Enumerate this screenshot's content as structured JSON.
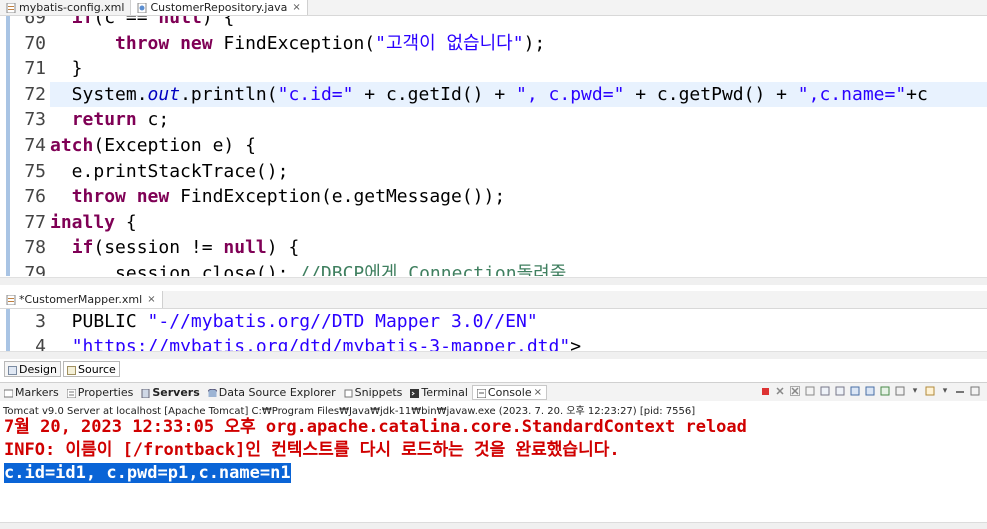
{
  "top_tabs": [
    {
      "label": "mybatis-config.xml",
      "active": false
    },
    {
      "label": "CustomerRepository.java",
      "active": true,
      "close": "×"
    }
  ],
  "java_editor": {
    "lines": [
      {
        "num": "69",
        "parts": [
          [
            "",
            "  "
          ],
          [
            "kw",
            "if"
          ],
          [
            "",
            "(c == "
          ],
          [
            "kw",
            "null"
          ],
          [
            "",
            ") {"
          ]
        ]
      },
      {
        "num": "70",
        "parts": [
          [
            "",
            "      "
          ],
          [
            "kw",
            "throw"
          ],
          [
            "",
            " "
          ],
          [
            "kw",
            "new"
          ],
          [
            "",
            " FindException("
          ],
          [
            "str",
            "\"고객이 없습니다\""
          ],
          [
            "",
            ");"
          ]
        ]
      },
      {
        "num": "71",
        "parts": [
          [
            "",
            "  }"
          ]
        ]
      },
      {
        "num": "72",
        "highlight": true,
        "parts": [
          [
            "",
            "  System."
          ],
          [
            "it",
            "out"
          ],
          [
            "",
            ".println("
          ],
          [
            "str",
            "\"c.id=\""
          ],
          [
            "",
            " + c.getId() + "
          ],
          [
            "str",
            "\", c.pwd=\""
          ],
          [
            "",
            " + c.getPwd() + "
          ],
          [
            "str",
            "\",c.name=\""
          ],
          [
            "",
            "+c"
          ]
        ]
      },
      {
        "num": "73",
        "parts": [
          [
            "",
            "  "
          ],
          [
            "kw",
            "return"
          ],
          [
            "",
            " c;"
          ]
        ]
      },
      {
        "num": "74",
        "parts": [
          [
            "kw",
            "atch"
          ],
          [
            "",
            "(Exception e) {"
          ]
        ]
      },
      {
        "num": "75",
        "parts": [
          [
            "",
            "  e.printStackTrace();"
          ]
        ]
      },
      {
        "num": "76",
        "parts": [
          [
            "",
            "  "
          ],
          [
            "kw",
            "throw"
          ],
          [
            "",
            " "
          ],
          [
            "kw",
            "new"
          ],
          [
            "",
            " FindException(e.getMessage());"
          ]
        ]
      },
      {
        "num": "77",
        "parts": [
          [
            "kw",
            "inally"
          ],
          [
            "",
            " {"
          ]
        ]
      },
      {
        "num": "78",
        "parts": [
          [
            "",
            "  "
          ],
          [
            "kw",
            "if"
          ],
          [
            "",
            "(session != "
          ],
          [
            "kw",
            "null"
          ],
          [
            "",
            ") {"
          ]
        ]
      },
      {
        "num": "79",
        "parts": [
          [
            "",
            "      session.close(); "
          ],
          [
            "cm",
            "//DBCP에게 Connection돌려줌"
          ]
        ]
      }
    ]
  },
  "mapper_tab": {
    "label": "*CustomerMapper.xml",
    "close": "×"
  },
  "mapper_editor": {
    "lines": [
      {
        "num": "3",
        "parts": [
          [
            "",
            "  PUBLIC "
          ],
          [
            "str",
            "\"-//mybatis.org//DTD Mapper 3.0//EN\""
          ]
        ]
      },
      {
        "num": "4",
        "parts": [
          [
            "",
            "  "
          ],
          [
            "str",
            "\"https://mybatis.org/dtd/mybatis-3-mapper.dtd\""
          ],
          [
            "",
            ">"
          ]
        ]
      }
    ]
  },
  "editor_subtabs": [
    {
      "label": "Design",
      "active": false
    },
    {
      "label": "Source",
      "active": true
    }
  ],
  "view_tabs": [
    {
      "label": "Markers",
      "icon": "markers-icon"
    },
    {
      "label": "Properties",
      "icon": "properties-icon"
    },
    {
      "label": "Servers",
      "icon": "servers-icon",
      "bold": true
    },
    {
      "label": "Data Source Explorer",
      "icon": "datasource-icon"
    },
    {
      "label": "Snippets",
      "icon": "snippets-icon"
    },
    {
      "label": "Terminal",
      "icon": "terminal-icon"
    },
    {
      "label": "Console",
      "icon": "console-icon",
      "active": true,
      "close": "×"
    }
  ],
  "console_title": "Tomcat v9.0 Server at localhost [Apache Tomcat] C:₩Program Files₩Java₩jdk-11₩bin₩javaw.exe  (2023. 7. 20. 오후 12:23:27) [pid: 7556]",
  "console_lines": [
    {
      "type": "err",
      "text": "7월 20, 2023 12:33:05 오후 org.apache.catalina.core.StandardContext reload"
    },
    {
      "type": "err",
      "text": "INFO: 이름이 [/frontback]인 컨텍스트를 다시 로드하는 것을 완료했습니다."
    },
    {
      "type": "sel",
      "text": "c.id=id1, c.pwd=p1,c.name=n1"
    }
  ],
  "colors": {
    "keyword": "#7f0055",
    "string": "#2a00ff",
    "error": "#d00000",
    "selection": "#0a64d6"
  }
}
